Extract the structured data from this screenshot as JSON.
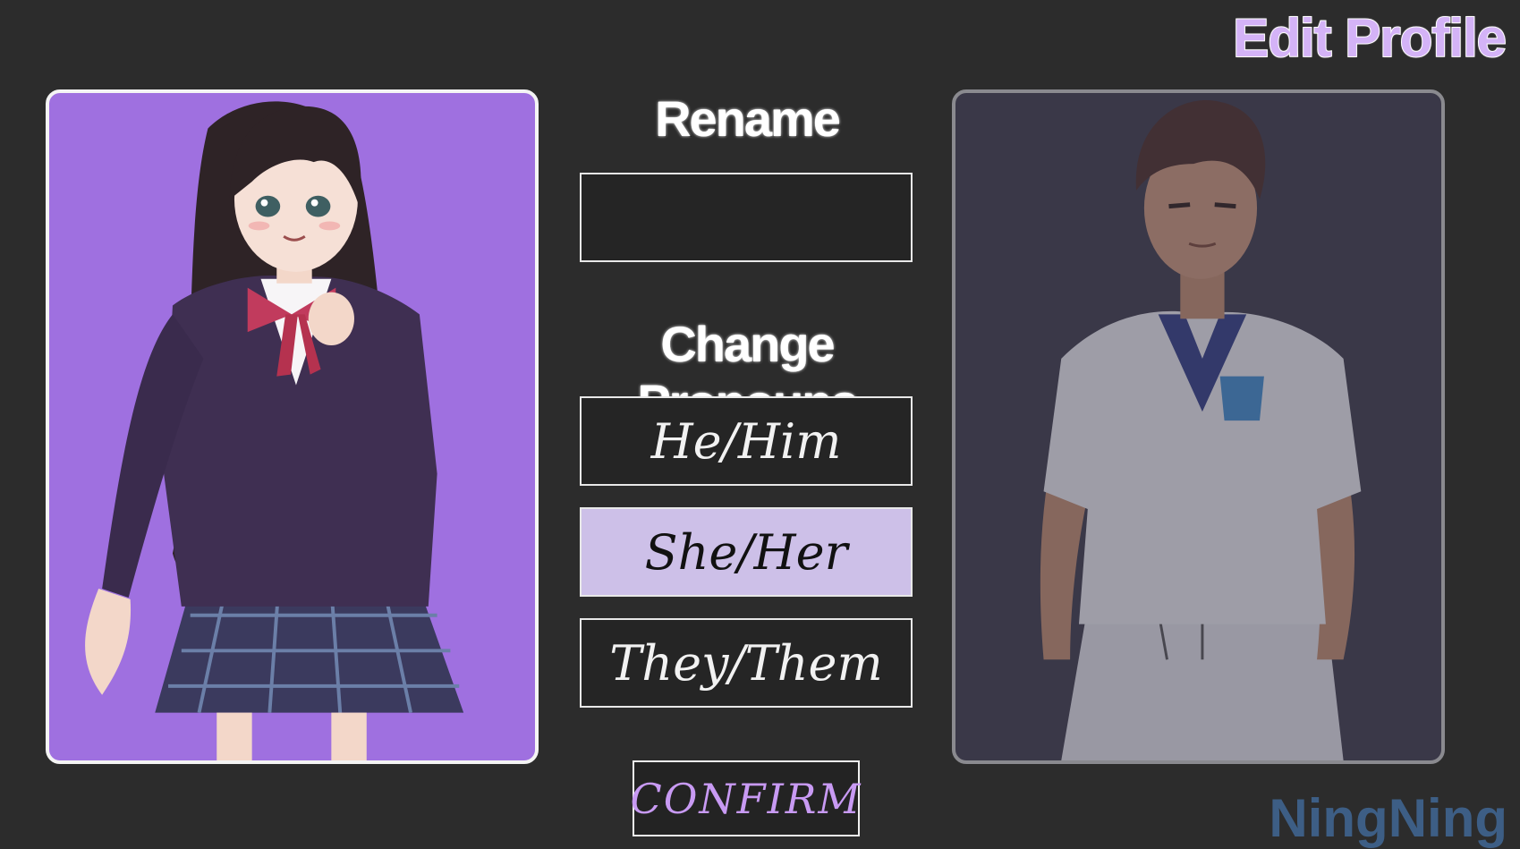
{
  "header": {
    "title": "Edit Profile"
  },
  "rename": {
    "heading": "Rename",
    "name_value": ""
  },
  "pronouns": {
    "heading": "Change Pronouns",
    "options": [
      {
        "label": "He/Him",
        "selected": false
      },
      {
        "label": "She/Her",
        "selected": true
      },
      {
        "label": "They/Them",
        "selected": false
      }
    ]
  },
  "actions": {
    "confirm_label": "CONFIRM"
  },
  "watermark": "NingNing",
  "colors": {
    "background": "#2c2c2c",
    "accent_purple": "#9f70e0",
    "selected_option": "#cdc0e8",
    "confirm_text": "#c89af3",
    "title_fill": "#d4b3f7"
  },
  "portraits": {
    "left": {
      "icon": "schoolgirl-character-portrait",
      "state": "active"
    },
    "right": {
      "icon": "schoolboy-character-portrait",
      "state": "dimmed"
    }
  }
}
